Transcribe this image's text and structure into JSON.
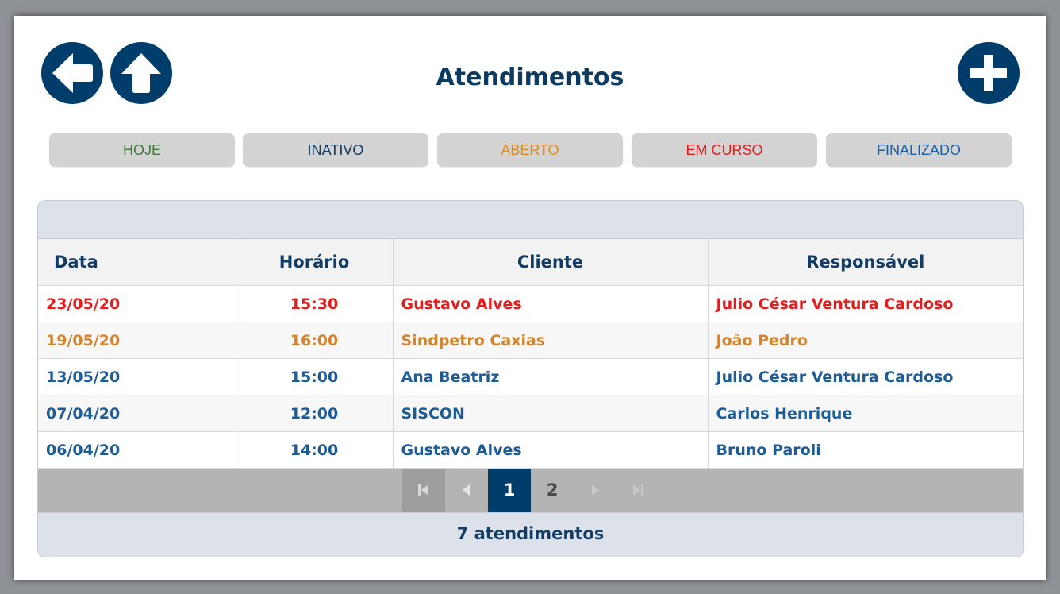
{
  "header": {
    "title": "Atendimentos",
    "back_icon": "arrow-left-icon",
    "home_icon": "arrow-up-icon",
    "add_icon": "plus-icon"
  },
  "filters": [
    {
      "label": "HOJE",
      "color": "#3c7a3a"
    },
    {
      "label": "INATIVO",
      "color": "#123c63"
    },
    {
      "label": "ABERTO",
      "color": "#e08a1e"
    },
    {
      "label": "EM CURSO",
      "color": "#e51c1c"
    },
    {
      "label": "FINALIZADO",
      "color": "#1a5fa8"
    }
  ],
  "table": {
    "columns": [
      "Data",
      "Horário",
      "Cliente",
      "Responsável"
    ],
    "rows": [
      {
        "data": "23/05/20",
        "horario": "15:30",
        "cliente": "Gustavo Alves",
        "responsavel": "Julio César Ventura Cardoso",
        "color": "#e51c1c"
      },
      {
        "data": "19/05/20",
        "horario": "16:00",
        "cliente": "Sindpetro Caxias",
        "responsavel": "João Pedro",
        "color": "#d6842a"
      },
      {
        "data": "13/05/20",
        "horario": "15:00",
        "cliente": "Ana Beatriz",
        "responsavel": "Julio César Ventura Cardoso",
        "color": "#1d5c95"
      },
      {
        "data": "07/04/20",
        "horario": "12:00",
        "cliente": "SISCON",
        "responsavel": "Carlos Henrique",
        "color": "#1d5c95"
      },
      {
        "data": "06/04/20",
        "horario": "14:00",
        "cliente": "Gustavo Alves",
        "responsavel": "Bruno Paroli",
        "color": "#1d5c95"
      }
    ]
  },
  "pagination": {
    "pages": [
      "1",
      "2"
    ],
    "current": "1",
    "first_icon": "first-page-icon",
    "prev_icon": "prev-page-icon",
    "next_icon": "next-page-icon",
    "last_icon": "last-page-icon"
  },
  "footer": {
    "count_text": "7 atendimentos"
  }
}
